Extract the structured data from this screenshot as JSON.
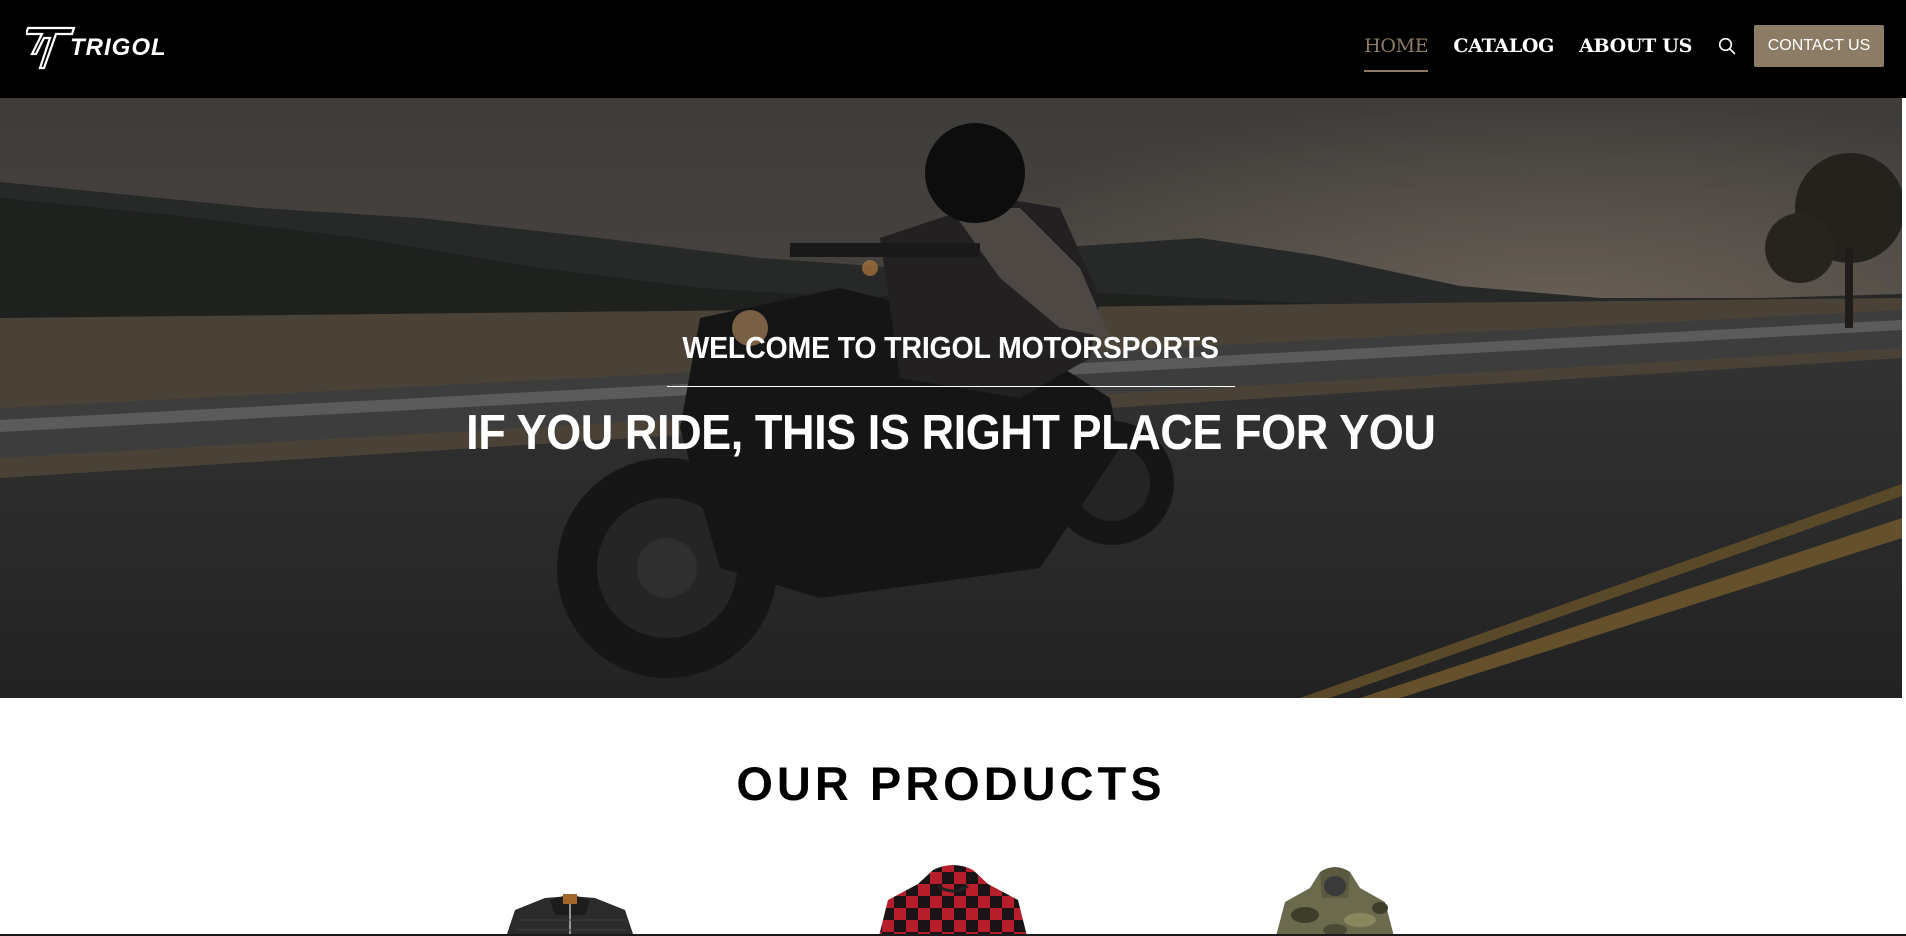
{
  "brand": {
    "name": "TRIGOL"
  },
  "nav": {
    "items": [
      {
        "label": "HOME",
        "active": true
      },
      {
        "label": "CATALOG",
        "active": false
      },
      {
        "label": "ABOUT US",
        "active": false
      }
    ],
    "search_icon": "search-icon",
    "contact_label": "CONTACT US"
  },
  "hero": {
    "subtitle": "WELCOME TO TRIGOL MOTORSPORTS",
    "title": "IF YOU RIDE, THIS IS RIGHT PLACE FOR YOU"
  },
  "products": {
    "title": "OUR PRODUCTS",
    "items": [
      {
        "image": "black-quilted-jacket"
      },
      {
        "image": "red-plaid-hoodie"
      },
      {
        "image": "camo-hoodie"
      }
    ]
  },
  "colors": {
    "header_bg": "#000000",
    "accent": "#8c7b65",
    "text_light": "#ffffff"
  }
}
